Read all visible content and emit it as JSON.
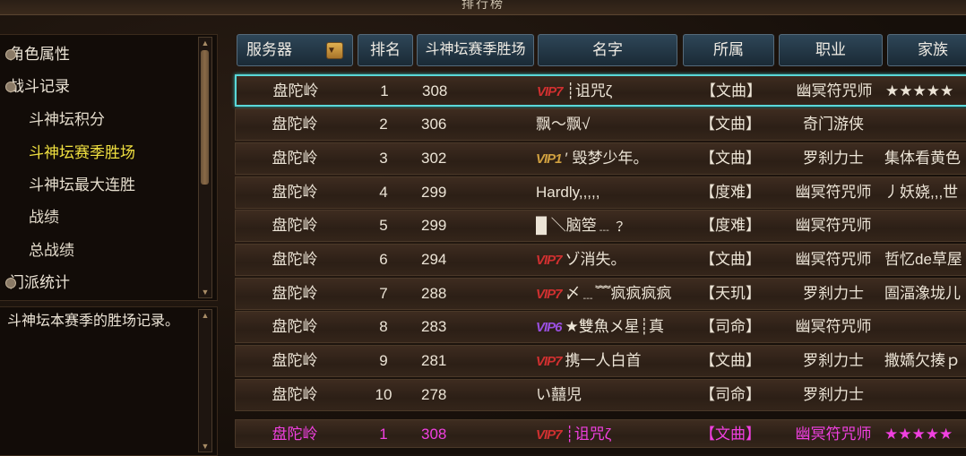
{
  "window": {
    "title": "排行榜"
  },
  "nav": {
    "items": [
      {
        "label": "角色属性",
        "kind": "cat"
      },
      {
        "label": "战斗记录",
        "kind": "cat"
      },
      {
        "label": "斗神坛积分",
        "kind": "sub"
      },
      {
        "label": "斗神坛赛季胜场",
        "kind": "sub",
        "active": true
      },
      {
        "label": "斗神坛最大连胜",
        "kind": "sub"
      },
      {
        "label": "战绩",
        "kind": "sub"
      },
      {
        "label": "总战绩",
        "kind": "sub"
      },
      {
        "label": "门派统计",
        "kind": "cat"
      }
    ]
  },
  "description": "斗神坛本赛季的胜场记录。",
  "table": {
    "headers": {
      "server": "服务器",
      "rank": "排名",
      "wins": "斗神坛赛季胜场",
      "name": "名字",
      "guild": "所属",
      "class": "职业",
      "family": "家族"
    },
    "rows": [
      {
        "server": "盘陀岭",
        "rank": "1",
        "wins": "308",
        "vip": "VIP7",
        "vip_color": "red",
        "name": "┊诅咒ζ",
        "guild": "【文曲】",
        "class": "幽冥符咒师",
        "family": "★★★★★"
      },
      {
        "server": "盘陀岭",
        "rank": "2",
        "wins": "306",
        "vip": "",
        "vip_color": "",
        "name": "飘～飘√",
        "guild": "【文曲】",
        "class": "奇门游侠",
        "family": ""
      },
      {
        "server": "盘陀岭",
        "rank": "3",
        "wins": "302",
        "vip": "VIP1",
        "vip_color": "gold",
        "name": "′ 毁梦少年。",
        "guild": "【文曲】",
        "class": "罗刹力士",
        "family": "集体看黄色"
      },
      {
        "server": "盘陀岭",
        "rank": "4",
        "wins": "299",
        "vip": "",
        "vip_color": "",
        "name": "Hardly,,,,,",
        "guild": "【度难】",
        "class": "幽冥符咒师",
        "family": "丿妖娆,,,世"
      },
      {
        "server": "盘陀岭",
        "rank": "5",
        "wins": "299",
        "vip": "",
        "vip_color": "",
        "name": "█ ＼脑箜﹍﹖",
        "guild": "【度难】",
        "class": "幽冥符咒师",
        "family": ""
      },
      {
        "server": "盘陀岭",
        "rank": "6",
        "wins": "294",
        "vip": "VIP7",
        "vip_color": "red",
        "name": "ゾ消失。",
        "guild": "【文曲】",
        "class": "幽冥符咒师",
        "family": "哲忆de草屋"
      },
      {
        "server": "盘陀岭",
        "rank": "7",
        "wins": "288",
        "vip": "VIP7",
        "vip_color": "red",
        "name": "〆﹍﹌疯疯疯疯",
        "guild": "【天玑】",
        "class": "罗刹力士",
        "family": "圄湢潒垅儿"
      },
      {
        "server": "盘陀岭",
        "rank": "8",
        "wins": "283",
        "vip": "VIP6",
        "vip_color": "purple",
        "name": "★雙魚メ星┊真",
        "guild": "【司命】",
        "class": "幽冥符咒师",
        "family": ""
      },
      {
        "server": "盘陀岭",
        "rank": "9",
        "wins": "281",
        "vip": "VIP7",
        "vip_color": "red",
        "name": "携一人白首",
        "guild": "【文曲】",
        "class": "罗刹力士",
        "family": "撒嬌欠揍ｐ"
      },
      {
        "server": "盘陀岭",
        "rank": "10",
        "wins": "278",
        "vip": "",
        "vip_color": "",
        "name": "い囍児",
        "guild": "【司命】",
        "class": "罗刹力士",
        "family": ""
      }
    ],
    "my_row": {
      "server": "盘陀岭",
      "rank": "1",
      "wins": "308",
      "vip": "VIP7",
      "vip_color": "red",
      "name": "┊诅咒ζ",
      "guild": "【文曲】",
      "class": "幽冥符咒师",
      "family": "★★★★★"
    }
  },
  "colors": {
    "selected_border": "#5ad8d8",
    "active_nav": "#f0e040",
    "my_row_text": "#f040e0"
  }
}
